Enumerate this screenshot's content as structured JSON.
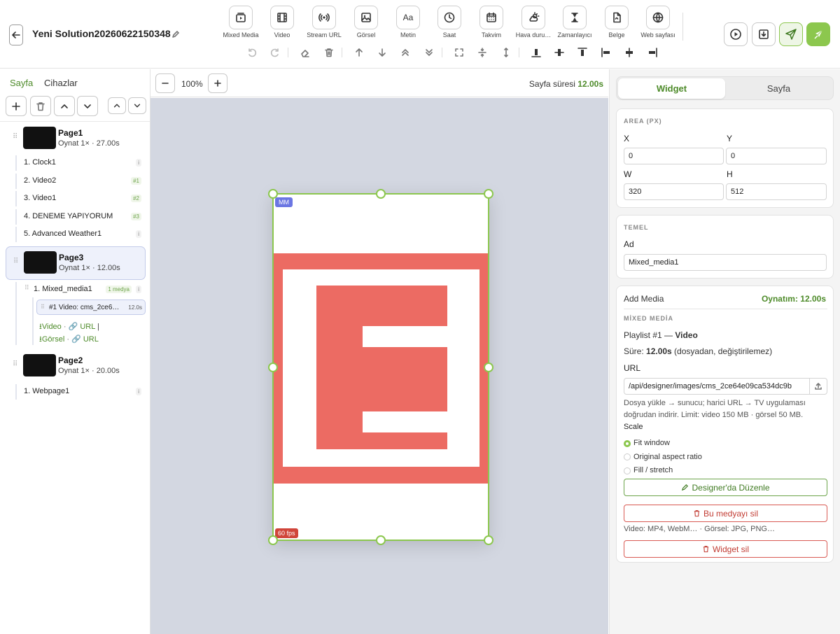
{
  "header": {
    "solution_title": "Yeni Solution20260622150348",
    "tools": [
      {
        "label": "Mixed Media",
        "icon": "mixed-media-icon"
      },
      {
        "label": "Video",
        "icon": "video-icon"
      },
      {
        "label": "Stream URL",
        "icon": "stream-icon"
      },
      {
        "label": "Görsel",
        "icon": "image-icon"
      },
      {
        "label": "Metin",
        "icon": "text-icon"
      },
      {
        "label": "Saat",
        "icon": "clock-icon"
      },
      {
        "label": "Takvim",
        "icon": "calendar-icon"
      },
      {
        "label": "Hava duru…",
        "icon": "weather-icon"
      },
      {
        "label": "Zamanlayıcı",
        "icon": "timer-icon"
      },
      {
        "label": "Belge",
        "icon": "document-icon"
      },
      {
        "label": "Web sayfası",
        "icon": "globe-icon"
      }
    ]
  },
  "left": {
    "tab_page": "Sayfa",
    "tab_devices": "Cihazlar",
    "pages": [
      {
        "name": "Page1",
        "meta": "Oynat 1× · 27.00s",
        "widgets": [
          {
            "label": "1.  Clock1",
            "badge": "i"
          },
          {
            "label": "2.  Video2",
            "badge": "#1"
          },
          {
            "label": "3.  Video1",
            "badge": "#2"
          },
          {
            "label": "4.  DENEME YAPIYORUM",
            "badge": "#3"
          },
          {
            "label": "5.  Advanced Weather1",
            "badge": "i"
          }
        ]
      },
      {
        "name": "Page3",
        "meta": "Oynat 1× · 12.00s",
        "widgets": [
          {
            "label": "1.  Mixed_media1",
            "badge": "1 medya",
            "info": "i"
          }
        ],
        "media_item": {
          "label": "#1  Video: cms_2ce6…",
          "duration": "12.0s"
        },
        "add_video": "Video",
        "add_image": "Görsel",
        "url": "URL"
      },
      {
        "name": "Page2",
        "meta": "Oynat 1× · 20.00s",
        "widgets": [
          {
            "label": "1.  Webpage1",
            "badge": "i"
          }
        ]
      }
    ]
  },
  "canvas": {
    "zoom": "100%",
    "duration_label": "Sayfa süresi",
    "duration_value": "12.00s",
    "widget_tag": "MM",
    "fps_tag": "60 fps",
    "media_colors": {
      "red": "#ec6b63",
      "white": "#ffffff"
    }
  },
  "right": {
    "tab_widget": "Widget",
    "tab_page": "Sayfa",
    "area_title": "AREA (PX)",
    "x_label": "X",
    "x_value": "0",
    "y_label": "Y",
    "y_value": "0",
    "w_label": "W",
    "w_value": "320",
    "h_label": "H",
    "h_value": "512",
    "basic_title": "TEMEL",
    "name_label": "Ad",
    "name_value": "Mixed_media1",
    "add_media": "Add Media",
    "playback": "Oynatım: 12.00s",
    "mixed_title": "MİXED MEDİA",
    "playlist_prefix": "Playlist #1 — ",
    "playlist_type": "Video",
    "duration_prefix": "Süre: ",
    "duration_value": "12.00s",
    "duration_suffix": " (dosyadan, değiştirilemez)",
    "url_label": "URL",
    "url_value": "/api/designer/images/cms_2ce64e09ca534dc9b",
    "help_line1": "Dosya yükle → sunucu; harici URL → TV uygulaması",
    "help_line2": "doğrudan indirir. Limit: video 150 MB · görsel 50 MB.",
    "scale_label": "Scale",
    "scale_options": [
      "Fit window",
      "Original aspect ratio",
      "Fill / stretch"
    ],
    "scale_selected": "Fit window",
    "edit_in_designer": "Designer'da Düzenle",
    "delete_media": "Bu medyayı sil",
    "formats": "Video: MP4, WebM… · Görsel: JPG, PNG…",
    "delete_widget": "Widget sil",
    "accent": "#8cc74e",
    "danger": "#d95a53"
  }
}
